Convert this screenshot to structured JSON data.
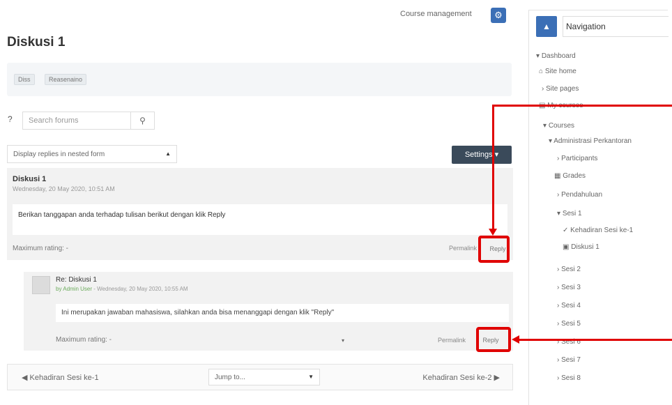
{
  "header": {
    "course_management_label": "Course management",
    "page_title": "Diskusi 1"
  },
  "breadcrumb": [
    "Diss",
    "Reasenaino"
  ],
  "search": {
    "placeholder": "Search forums"
  },
  "display_mode": {
    "selected": "Display replies in nested form"
  },
  "settings_label": "Settings ▾",
  "post1": {
    "subject": "Diskusi 1",
    "meta": "Wednesday, 20 May 2020, 10:51 AM",
    "body": "Berikan tanggapan anda terhadap tulisan berikut dengan klik Reply",
    "rating": "Maximum rating: -",
    "permalink": "Permalink",
    "reply": "Reply"
  },
  "post2": {
    "subject": "Re: Diskusi 1",
    "author": "by Admin User",
    "meta_suffix": " - Wednesday, 20 May 2020, 10:55 AM",
    "body": "Ini merupakan jawaban mahasiswa, silahkan anda bisa menanggapi dengan klik \"Reply\"",
    "rating": "Maximum rating: -",
    "rating_caret": "▾",
    "permalink": "Permalink",
    "reply": "Reply"
  },
  "bottom_nav": {
    "prev": "◀ Kehadiran Sesi ke-1",
    "jump": "Jump to...",
    "next": "Kehadiran Sesi ke-2 ▶"
  },
  "sidebar": {
    "title": "Navigation",
    "items": [
      "Dashboard",
      "Site home",
      "Site pages",
      "My courses",
      "Courses",
      "Administrasi Perkantoran",
      "Participants",
      "Grades",
      "Pendahuluan",
      "Sesi 1",
      "Kehadiran Sesi ke-1",
      "Diskusi 1",
      "Sesi 2",
      "Sesi 3",
      "Sesi 4",
      "Sesi 5",
      "Sesi 6",
      "Sesi 7",
      "Sesi 8"
    ]
  },
  "colors": {
    "accent": "#3b6fb6",
    "highlight": "#e00000",
    "settings_button": "#3a4a5a"
  }
}
